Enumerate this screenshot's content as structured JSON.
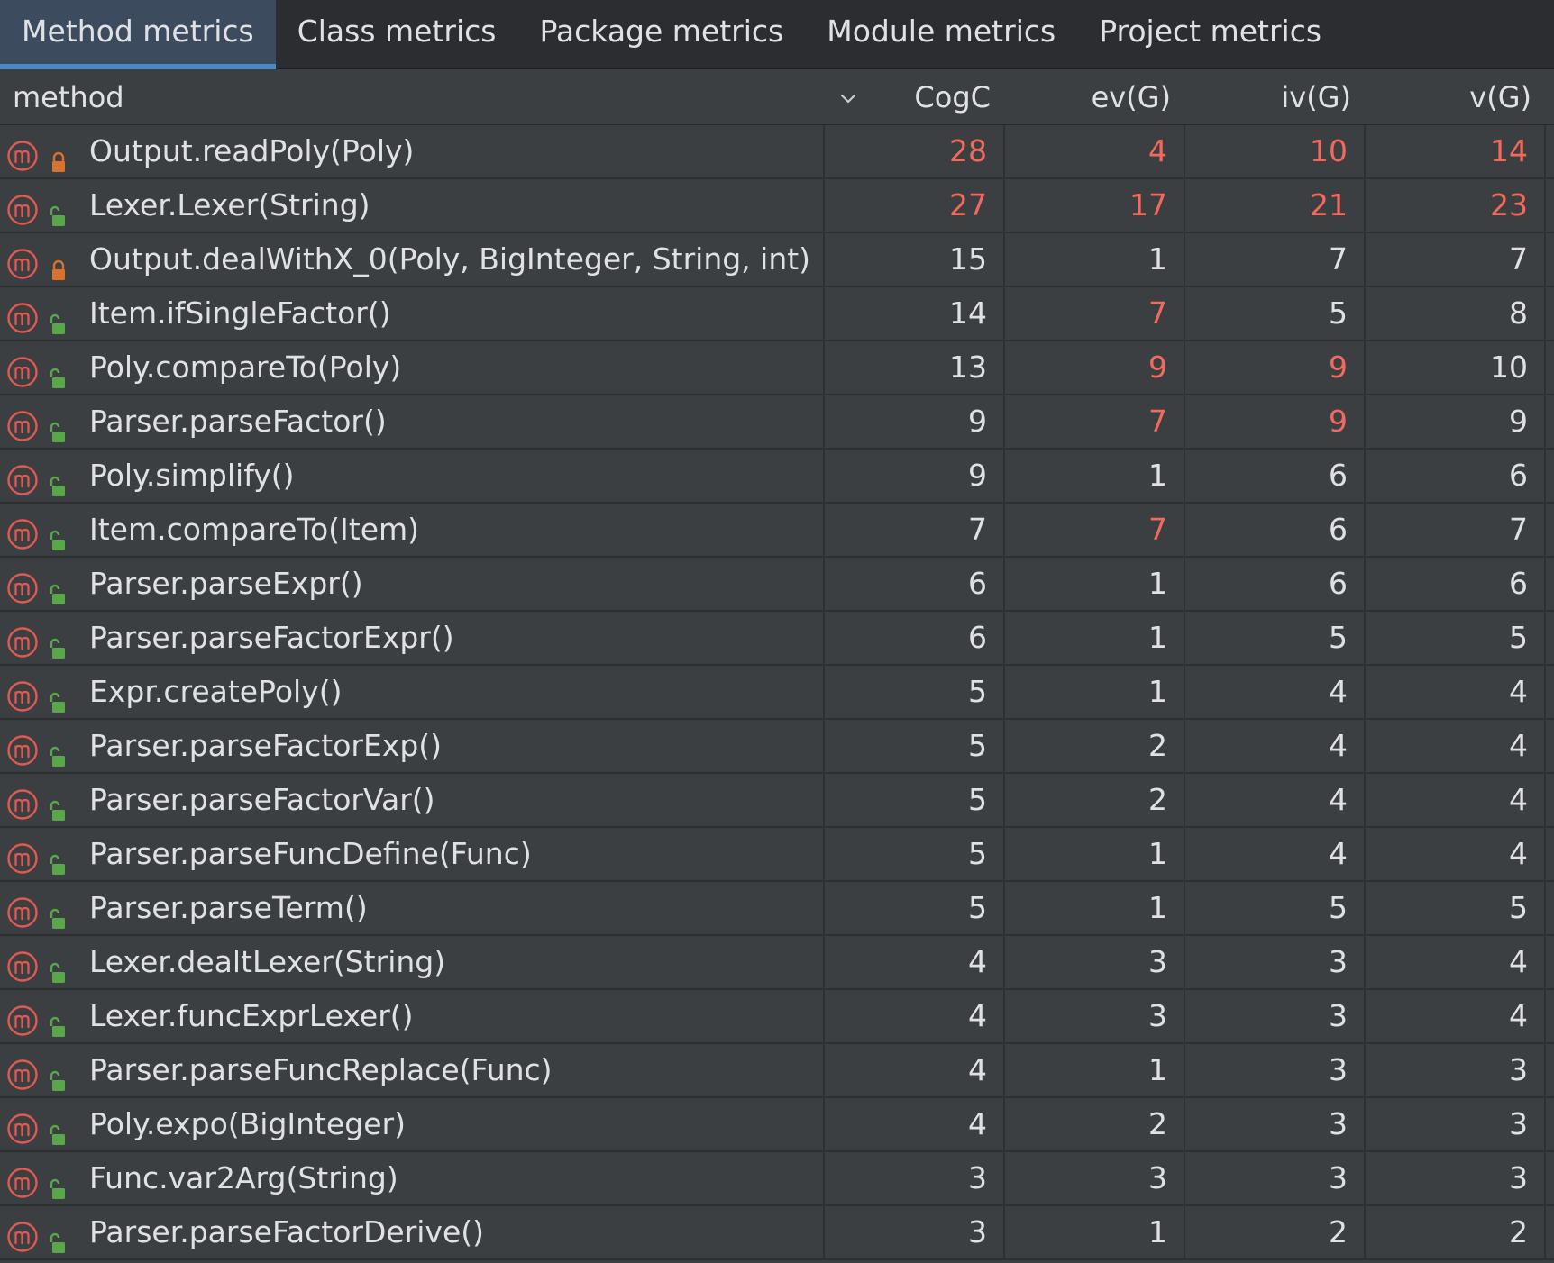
{
  "tabs": [
    {
      "label": "Method metrics",
      "active": true
    },
    {
      "label": "Class metrics",
      "active": false
    },
    {
      "label": "Package metrics",
      "active": false
    },
    {
      "label": "Module metrics",
      "active": false
    },
    {
      "label": "Project metrics",
      "active": false
    }
  ],
  "table": {
    "columns": {
      "method": "method",
      "cogc": "CogC",
      "evg": "ev(G)",
      "ivg": "iv(G)",
      "vg": "v(G)"
    },
    "sort_icon": "chevron-down-icon",
    "colors": {
      "highlight": "#f26a5e",
      "normal": "#dfe1e5",
      "method_icon": "#e05a52",
      "private_lock": "#d9722e",
      "public_lock": "#59a64b"
    },
    "rows": [
      {
        "name": "Output.readPoly(Poly)",
        "access": "private",
        "cogc": "28",
        "evg": "4",
        "ivg": "10",
        "vg": "14",
        "hot": [
          true,
          true,
          true,
          true
        ]
      },
      {
        "name": "Lexer.Lexer(String)",
        "access": "public",
        "cogc": "27",
        "evg": "17",
        "ivg": "21",
        "vg": "23",
        "hot": [
          true,
          true,
          true,
          true
        ]
      },
      {
        "name": "Output.dealWithX_0(Poly, BigInteger, String, int)",
        "access": "private",
        "cogc": "15",
        "evg": "1",
        "ivg": "7",
        "vg": "7",
        "hot": [
          false,
          false,
          false,
          false
        ]
      },
      {
        "name": "Item.ifSingleFactor()",
        "access": "public",
        "cogc": "14",
        "evg": "7",
        "ivg": "5",
        "vg": "8",
        "hot": [
          false,
          true,
          false,
          false
        ]
      },
      {
        "name": "Poly.compareTo(Poly)",
        "access": "public",
        "cogc": "13",
        "evg": "9",
        "ivg": "9",
        "vg": "10",
        "hot": [
          false,
          true,
          true,
          false
        ]
      },
      {
        "name": "Parser.parseFactor()",
        "access": "public",
        "cogc": "9",
        "evg": "7",
        "ivg": "9",
        "vg": "9",
        "hot": [
          false,
          true,
          true,
          false
        ]
      },
      {
        "name": "Poly.simplify()",
        "access": "public",
        "cogc": "9",
        "evg": "1",
        "ivg": "6",
        "vg": "6",
        "hot": [
          false,
          false,
          false,
          false
        ]
      },
      {
        "name": "Item.compareTo(Item)",
        "access": "public",
        "cogc": "7",
        "evg": "7",
        "ivg": "6",
        "vg": "7",
        "hot": [
          false,
          true,
          false,
          false
        ]
      },
      {
        "name": "Parser.parseExpr()",
        "access": "public",
        "cogc": "6",
        "evg": "1",
        "ivg": "6",
        "vg": "6",
        "hot": [
          false,
          false,
          false,
          false
        ]
      },
      {
        "name": "Parser.parseFactorExpr()",
        "access": "public",
        "cogc": "6",
        "evg": "1",
        "ivg": "5",
        "vg": "5",
        "hot": [
          false,
          false,
          false,
          false
        ]
      },
      {
        "name": "Expr.createPoly()",
        "access": "public",
        "cogc": "5",
        "evg": "1",
        "ivg": "4",
        "vg": "4",
        "hot": [
          false,
          false,
          false,
          false
        ]
      },
      {
        "name": "Parser.parseFactorExp()",
        "access": "public",
        "cogc": "5",
        "evg": "2",
        "ivg": "4",
        "vg": "4",
        "hot": [
          false,
          false,
          false,
          false
        ]
      },
      {
        "name": "Parser.parseFactorVar()",
        "access": "public",
        "cogc": "5",
        "evg": "2",
        "ivg": "4",
        "vg": "4",
        "hot": [
          false,
          false,
          false,
          false
        ]
      },
      {
        "name": "Parser.parseFuncDefine(Func)",
        "access": "public",
        "cogc": "5",
        "evg": "1",
        "ivg": "4",
        "vg": "4",
        "hot": [
          false,
          false,
          false,
          false
        ]
      },
      {
        "name": "Parser.parseTerm()",
        "access": "public",
        "cogc": "5",
        "evg": "1",
        "ivg": "5",
        "vg": "5",
        "hot": [
          false,
          false,
          false,
          false
        ]
      },
      {
        "name": "Lexer.dealtLexer(String)",
        "access": "public",
        "cogc": "4",
        "evg": "3",
        "ivg": "3",
        "vg": "4",
        "hot": [
          false,
          false,
          false,
          false
        ]
      },
      {
        "name": "Lexer.funcExprLexer()",
        "access": "public",
        "cogc": "4",
        "evg": "3",
        "ivg": "3",
        "vg": "4",
        "hot": [
          false,
          false,
          false,
          false
        ]
      },
      {
        "name": "Parser.parseFuncReplace(Func)",
        "access": "public",
        "cogc": "4",
        "evg": "1",
        "ivg": "3",
        "vg": "3",
        "hot": [
          false,
          false,
          false,
          false
        ]
      },
      {
        "name": "Poly.expo(BigInteger)",
        "access": "public",
        "cogc": "4",
        "evg": "2",
        "ivg": "3",
        "vg": "3",
        "hot": [
          false,
          false,
          false,
          false
        ]
      },
      {
        "name": "Func.var2Arg(String)",
        "access": "public",
        "cogc": "3",
        "evg": "3",
        "ivg": "3",
        "vg": "3",
        "hot": [
          false,
          false,
          false,
          false
        ]
      },
      {
        "name": "Parser.parseFactorDerive()",
        "access": "public",
        "cogc": "3",
        "evg": "1",
        "ivg": "2",
        "vg": "2",
        "hot": [
          false,
          false,
          false,
          false
        ]
      }
    ]
  }
}
